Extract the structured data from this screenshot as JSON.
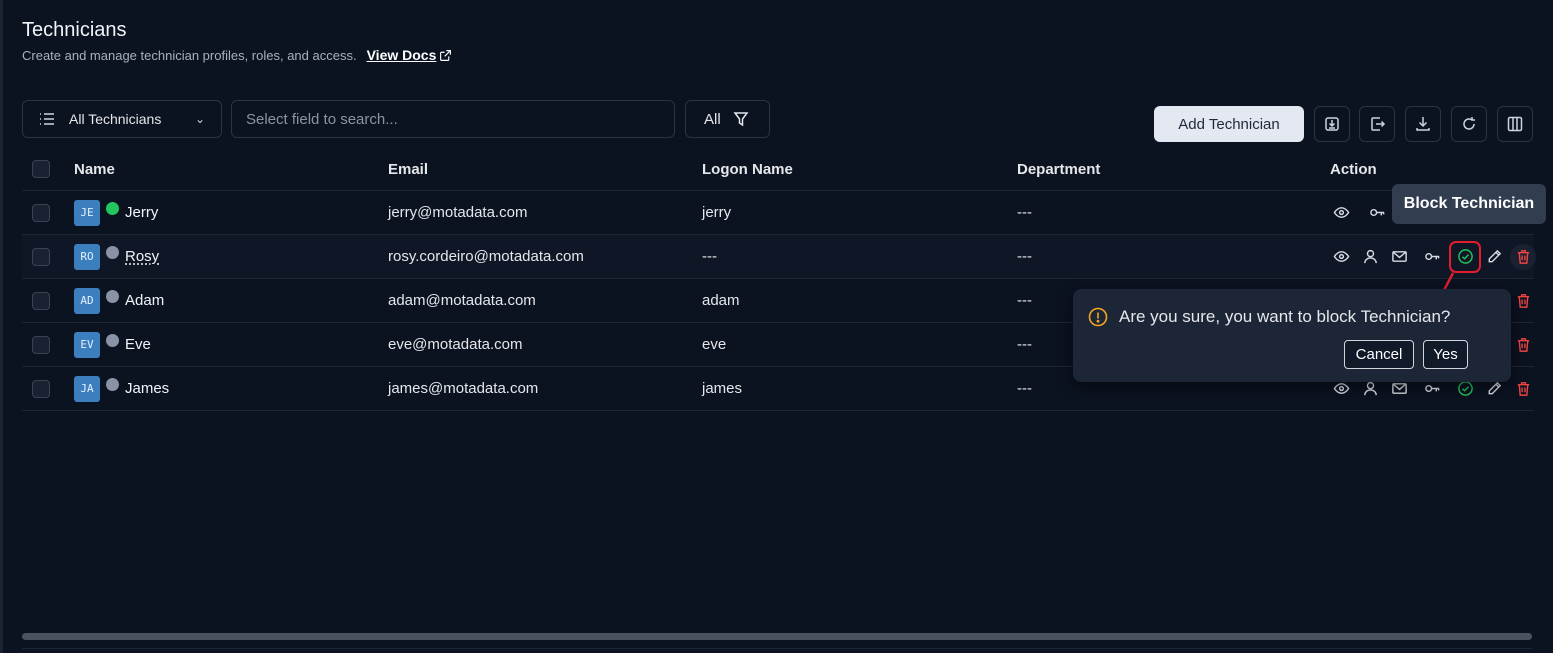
{
  "header": {
    "title": "Technicians",
    "subtitle": "Create and manage technician profiles, roles, and access.",
    "docs_link": "View Docs"
  },
  "toolbar": {
    "view_label": "All Technicians",
    "search_placeholder": "Select field to search...",
    "filter_label": "All",
    "add_label": "Add Technician",
    "icon_buttons": [
      "import-icon",
      "export-icon",
      "download-icon",
      "refresh-icon",
      "columns-icon"
    ]
  },
  "table": {
    "columns": [
      "Name",
      "Email",
      "Logon Name",
      "Department",
      "Action"
    ],
    "rows": [
      {
        "initials": "JE",
        "name": "Jerry",
        "status": "active",
        "email": "jerry@motadata.com",
        "logon": "jerry",
        "department": "---"
      },
      {
        "initials": "RO",
        "name": "Rosy",
        "status": "inactive",
        "email": "rosy.cordeiro@motadata.com",
        "logon": "---",
        "department": "---"
      },
      {
        "initials": "AD",
        "name": "Adam",
        "status": "inactive",
        "email": "adam@motadata.com",
        "logon": "adam",
        "department": "---"
      },
      {
        "initials": "EV",
        "name": "Eve",
        "status": "inactive",
        "email": "eve@motadata.com",
        "logon": "eve",
        "department": "---"
      },
      {
        "initials": "JA",
        "name": "James",
        "status": "inactive",
        "email": "james@motadata.com",
        "logon": "james",
        "department": "---"
      }
    ]
  },
  "tooltip": {
    "text": "Block Technician"
  },
  "popconfirm": {
    "message": "Are you sure, you want to block Technician?",
    "cancel_label": "Cancel",
    "confirm_label": "Yes"
  },
  "colors": {
    "background": "#0b1220",
    "accent_green": "#22c55e",
    "danger_red": "#ef4444",
    "highlight_box": "#e11d2e",
    "warning": "#f5a623",
    "avatar": "#3b7fbf"
  }
}
